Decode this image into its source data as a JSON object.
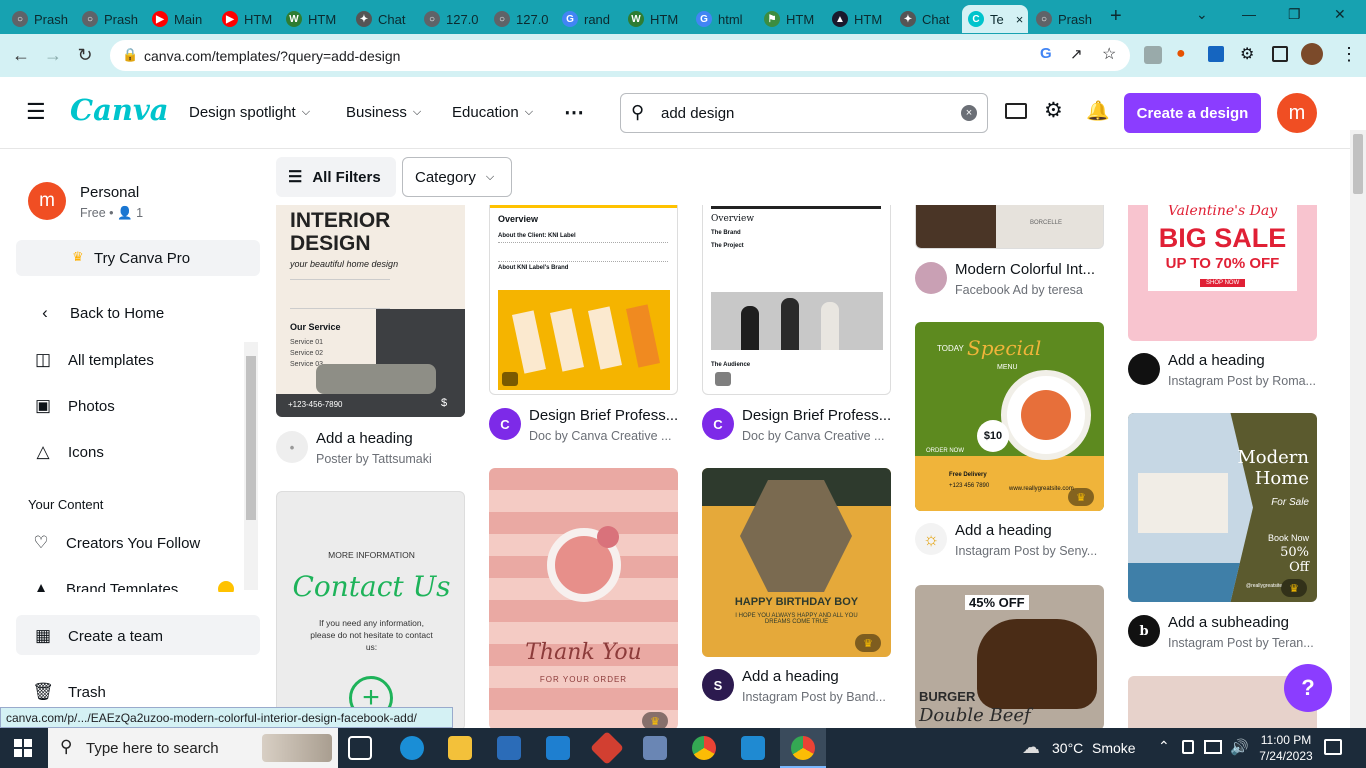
{
  "browser": {
    "tabs": [
      {
        "title": "Prash",
        "favicon": "globe-icon",
        "color": "#5f6368"
      },
      {
        "title": "Prash",
        "favicon": "globe-icon",
        "color": "#5f6368"
      },
      {
        "title": "Main",
        "favicon": "youtube-icon",
        "color": "#ff0000"
      },
      {
        "title": "HTM",
        "favicon": "youtube-icon",
        "color": "#ff0000"
      },
      {
        "title": "HTM",
        "favicon": "w-icon",
        "color": "#2e7d32"
      },
      {
        "title": "Chat",
        "favicon": "openai-icon",
        "color": "#555555"
      },
      {
        "title": "127.0",
        "favicon": "globe-icon",
        "color": "#5f6368"
      },
      {
        "title": "127.0",
        "favicon": "globe-icon",
        "color": "#5f6368"
      },
      {
        "title": "rand",
        "favicon": "google-icon",
        "color": "#4285f4"
      },
      {
        "title": "HTM",
        "favicon": "w-icon",
        "color": "#2e7d32"
      },
      {
        "title": "html",
        "favicon": "google-icon",
        "color": "#4285f4"
      },
      {
        "title": "HTM",
        "favicon": "book-icon",
        "color": "#3c8d40"
      },
      {
        "title": "HTM",
        "favicon": "a-icon",
        "color": "#1a1a2e"
      },
      {
        "title": "Chat",
        "favicon": "openai-icon",
        "color": "#555555"
      },
      {
        "title": "Te",
        "favicon": "canva-icon",
        "color": "#00c4cc",
        "active": true
      },
      {
        "title": "Prash",
        "favicon": "globe-icon",
        "color": "#5f6368"
      }
    ],
    "url": "canva.com/templates/?query=add-design",
    "status_url": "canva.com/p/.../EAEzQa2uzoo-modern-colorful-interior-design-facebook-add/"
  },
  "header": {
    "logo": "Canva",
    "nav": [
      "Design spotlight",
      "Business",
      "Education"
    ],
    "search_value": "add design",
    "create_label": "Create a design",
    "avatar_letter": "m",
    "accent": "#8b3dff"
  },
  "filters": {
    "all_filters": "All Filters",
    "category": "Category"
  },
  "sidebar": {
    "account_name": "Personal",
    "account_plan": "Free • ",
    "account_members": "1",
    "try_pro": "Try Canva Pro",
    "items": [
      {
        "label": "Back to Home",
        "icon": "chevron-left-icon"
      },
      {
        "label": "All templates",
        "icon": "templates-icon"
      },
      {
        "label": "Photos",
        "icon": "photo-icon"
      },
      {
        "label": "Icons",
        "icon": "shapes-icon"
      }
    ],
    "your_content_heading": "Your Content",
    "content_items": [
      {
        "label": "Creators You Follow",
        "icon": "heart-icon"
      },
      {
        "label": "Brand Templates",
        "icon": "brand-icon"
      }
    ],
    "create_team": "Create a team",
    "trash": "Trash"
  },
  "cards": [
    {
      "title": "Add a heading",
      "subtitle": "Poster by Tattsumaki",
      "thumb_title": "INTERIOR DESIGN",
      "thumb_sub": "your beautiful home design",
      "thumb_section": "Our Service",
      "thumb_services": [
        "Service 01",
        "Service 02",
        "Service 03"
      ],
      "thumb_phone": "+123-456-7890"
    },
    {
      "title": "Design Brief Profess...",
      "subtitle": "Doc by Canva Creative ...",
      "thumb_heading": "Overview",
      "thumb_client": "About the Client: KNI Label",
      "thumb_brand": "About KNI Label's Brand"
    },
    {
      "title": "Design Brief Profess...",
      "subtitle": "Doc by Canva Creative ...",
      "thumb_heading": "Overview",
      "thumb_brand": "The Brand",
      "thumb_project": "The Project",
      "thumb_audience": "The Audience"
    },
    {
      "title": "Modern Colorful Int...",
      "subtitle": "Facebook Ad by teresa",
      "thumb_brand": "BORCELLE"
    },
    {
      "title": "Add a heading",
      "subtitle": "Instagram Post by Roma...",
      "thumb_line1": "Valentine's Day",
      "thumb_line2": "BIG SALE",
      "thumb_line3": "UP TO 70% OFF",
      "thumb_button": "SHOP NOW"
    },
    {
      "title": "",
      "subtitle": "",
      "thumb_line1": "MORE INFORMATION",
      "thumb_line2": "Contact Us",
      "thumb_line3": "If you need any information, please do not hesitate to contact us:"
    },
    {
      "title": "",
      "subtitle": "",
      "thumb_line1": "Thank You",
      "thumb_line2": "FOR YOUR ORDER"
    },
    {
      "title": "Add a heading",
      "subtitle": "Instagram Post by Band...",
      "thumb_line1": "HAPPY BIRTHDAY BOY",
      "thumb_line2": "I HOPE YOU ALWAYS HAPPY AND ALL YOU DREAMS COME TRUE"
    },
    {
      "title": "Add a heading",
      "subtitle": "Instagram Post by Seny...",
      "thumb_line1": "TODAY",
      "thumb_line2": "Special",
      "thumb_line3": "MENU",
      "thumb_price": "$10",
      "thumb_order": "ORDER NOW",
      "thumb_delivery": "Free Delivery",
      "thumb_phone": "+123 456 7890",
      "thumb_site": "www.reallygreatsite.com"
    },
    {
      "title": "Add a subheading",
      "subtitle": "Instagram Post by Teran...",
      "thumb_line1": "Modern Home",
      "thumb_line2": "For Sale",
      "thumb_line3": "Book Now",
      "thumb_line4": "50% Off",
      "thumb_handle": "@reallygreatsite"
    },
    {
      "title": "",
      "subtitle": "",
      "thumb_line1": "45% OFF",
      "thumb_line2": "BURGER",
      "thumb_line3": "Double Beef"
    }
  ],
  "help_label": "?",
  "taskbar": {
    "search_placeholder": "Type here to search",
    "weather_temp": "30°C",
    "weather_desc": "Smoke",
    "time": "11:00 PM",
    "date": "7/24/2023"
  }
}
